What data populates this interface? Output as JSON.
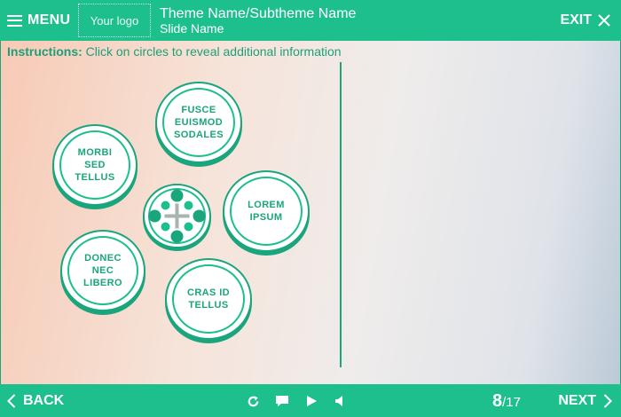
{
  "header": {
    "menu_label": "MENU",
    "logo_text": "Your logo",
    "title": "Theme Name/Subtheme Name",
    "slide_name": "Slide Name",
    "exit_label": "EXIT"
  },
  "instructions": {
    "label": "Instructions:",
    "text": "Click on circles to reveal additional information"
  },
  "circles": [
    {
      "lines": [
        "FUSCE",
        "EUISMOD",
        "SODALES"
      ]
    },
    {
      "lines": [
        "MORBI",
        "SED",
        "TELLUS"
      ]
    },
    {
      "lines": [
        "LOREM",
        "IPSUM"
      ]
    },
    {
      "lines": [
        "DONEC",
        "NEC",
        "LIBERO"
      ]
    },
    {
      "lines": [
        "CRAS ID",
        "TELLUS"
      ]
    }
  ],
  "footer": {
    "back_label": "BACK",
    "next_label": "NEXT",
    "page_current": "8",
    "page_total": "/17"
  },
  "colors": {
    "accent": "#1dbf8d",
    "accent_dark": "#1aa57c",
    "instruction_text": "#1c9f7a"
  },
  "icons": [
    "menu-icon",
    "close-icon",
    "chevron-left-icon",
    "chevron-right-icon",
    "replay-icon",
    "comment-icon",
    "play-icon",
    "volume-icon",
    "plus-icon"
  ]
}
